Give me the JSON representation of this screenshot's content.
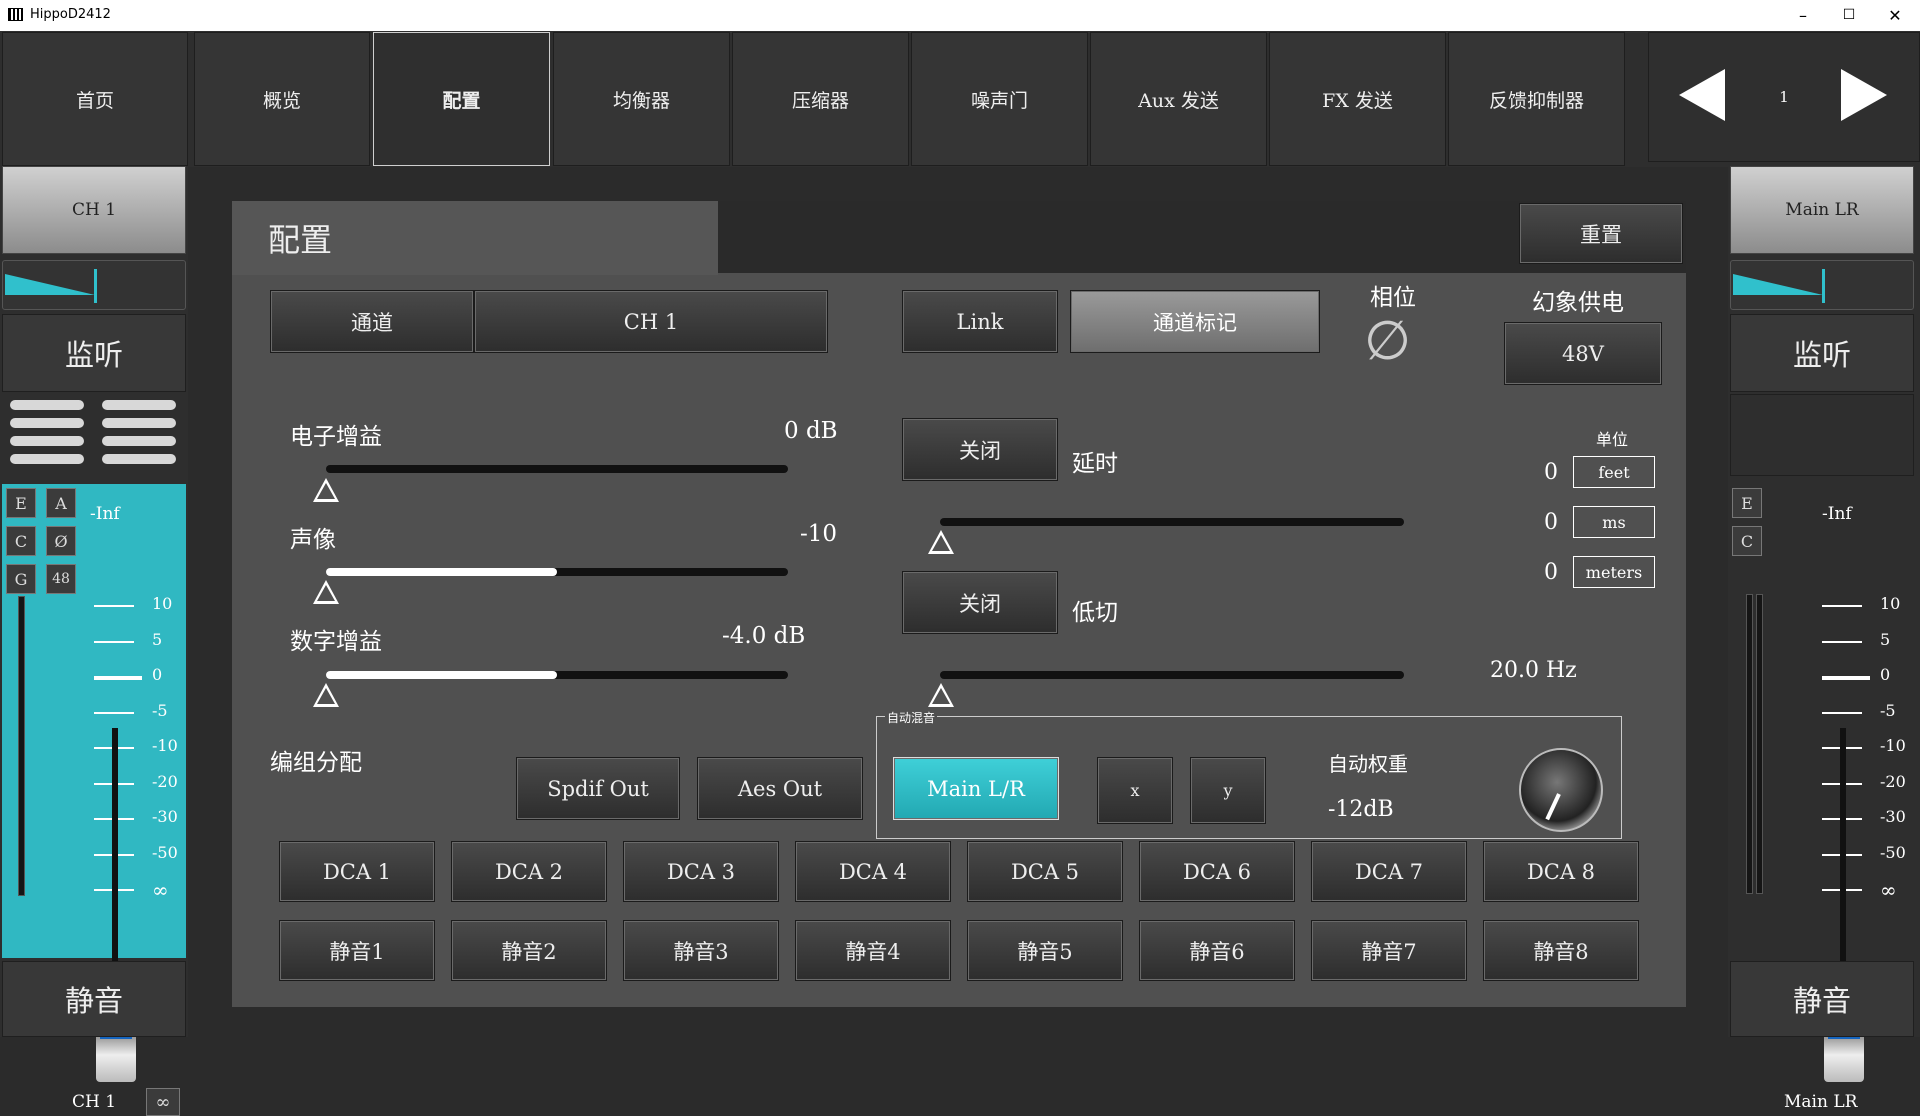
{
  "window": {
    "title": "HippoD2412",
    "min": "–",
    "max": "☐",
    "close": "✕"
  },
  "nav": {
    "tabs": [
      "首页",
      "概览",
      "配置",
      "均衡器",
      "压缩器",
      "噪声门",
      "Aux 发送",
      "FX 发送",
      "反馈抑制器"
    ],
    "active": "配置",
    "page": "1"
  },
  "left_strip": {
    "channel": "CH 1",
    "monitor": "监听",
    "mute": "静音",
    "level": "-Inf",
    "buttons": [
      "E",
      "A",
      "C",
      "Ø",
      "G",
      "48"
    ],
    "ticks": [
      "10",
      "5",
      "0",
      "-5",
      "-10",
      "-20",
      "-30",
      "-50",
      "∞"
    ],
    "name": "CH 1",
    "link_icon": "link-icon",
    "pan_fraction": 0.4,
    "fader_position": "∞"
  },
  "right_strip": {
    "channel": "Main LR",
    "monitor": "监听",
    "mute": "静音",
    "level": "-Inf",
    "buttons": [
      "E",
      "C"
    ],
    "ticks": [
      "10",
      "5",
      "0",
      "-5",
      "-10",
      "-20",
      "-30",
      "-50",
      "∞"
    ],
    "name": "Main LR"
  },
  "config": {
    "title": "配置",
    "reset": "重置",
    "channel_label": "通道",
    "channel_value": "CH 1",
    "link": "Link",
    "channel_mark": "通道标记",
    "phase_label": "相位",
    "phase_symbol": "∅",
    "phantom_label": "幻象供电",
    "phantom_btn": "48V",
    "gain": {
      "label": "电子增益",
      "value": "0 dB",
      "fraction": 0
    },
    "pan": {
      "label": "声像",
      "value": "-10",
      "fraction": 0.5
    },
    "digital_gain": {
      "label": "数字增益",
      "value": "-4.0 dB",
      "fraction": 0.5
    },
    "delay": {
      "toggle": "关闭",
      "label": "延时",
      "fraction": 0
    },
    "units": {
      "label": "单位",
      "items": [
        {
          "value": "0",
          "unit": "feet"
        },
        {
          "value": "0",
          "unit": "ms"
        },
        {
          "value": "0",
          "unit": "meters"
        }
      ]
    },
    "lowcut": {
      "toggle": "关闭",
      "label": "低切",
      "value": "20.0 Hz",
      "fraction": 0
    },
    "group_label": "编组分配",
    "spdif": "Spdif Out",
    "aes": "Aes Out",
    "automix": {
      "legend": "自动混音",
      "main": "Main L/R",
      "x": "x",
      "y": "y",
      "weight_label": "自动权重",
      "weight_value": "-12dB"
    },
    "dca": [
      "DCA 1",
      "DCA 2",
      "DCA 3",
      "DCA 4",
      "DCA 5",
      "DCA 6",
      "DCA 7",
      "DCA 8"
    ],
    "mutes": [
      "静音1",
      "静音2",
      "静音3",
      "静音4",
      "静音5",
      "静音6",
      "静音7",
      "静音8"
    ]
  }
}
